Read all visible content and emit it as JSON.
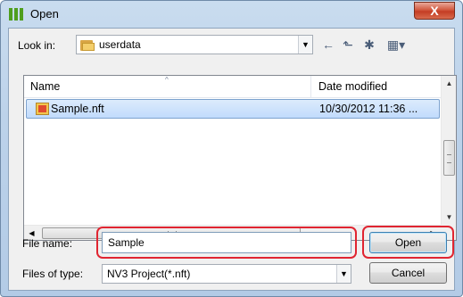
{
  "window": {
    "title": "Open",
    "close_glyph": "X",
    "accent_color": "#e02531"
  },
  "look_in": {
    "label": "Look in:",
    "value": "userdata",
    "arrow": "▼"
  },
  "toolbar": {
    "back_icon": "←",
    "up_icon": "⬑",
    "new_folder_icon": "✱",
    "view_icon": "▦▾"
  },
  "file_list": {
    "columns": [
      "Name",
      "Date modified"
    ],
    "sort_indicator": "^",
    "rows": [
      {
        "name": "Sample.nft",
        "date": "10/30/2012 11:36 ..."
      }
    ]
  },
  "scroll": {
    "up": "▲",
    "down": "▼",
    "left": "◀",
    "right": "▶",
    "h_grip": "III",
    "v_grip": "≡"
  },
  "file_name": {
    "label": "File name:",
    "value": "Sample"
  },
  "file_type": {
    "label": "Files of type:",
    "value": "NV3 Project(*.nft)",
    "arrow": "▼"
  },
  "buttons": {
    "open": "Open",
    "cancel": "Cancel"
  }
}
